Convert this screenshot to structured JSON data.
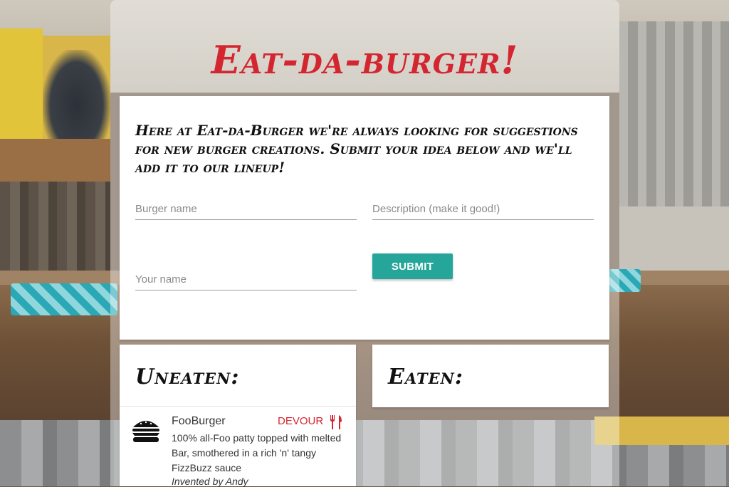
{
  "brand": {
    "title": "Eat-da-burger!"
  },
  "intro": "Here at Eat-da-Burger we're always looking for suggestions for new burger creations. Submit your idea below and we'll add it to our lineup!",
  "form": {
    "burger_name_placeholder": "Burger name",
    "description_placeholder": "Description (make it good!)",
    "your_name_placeholder": "Your name",
    "submit_label": "SUBMIT"
  },
  "uneaten": {
    "heading": "Uneaten:",
    "items": [
      {
        "name": "FooBurger",
        "description": "100% all-Foo patty topped with melted Bar, smothered in a rich 'n' tangy FizzBuzz sauce",
        "invented_by": "Invented by Andy",
        "action_label": "DEVOUR",
        "icon": "burger-icon",
        "action_icon": "fork-knife-icon"
      }
    ]
  },
  "eaten": {
    "heading": "Eaten:"
  },
  "colors": {
    "brand_red": "#d42630",
    "submit_teal": "#26a69a"
  }
}
